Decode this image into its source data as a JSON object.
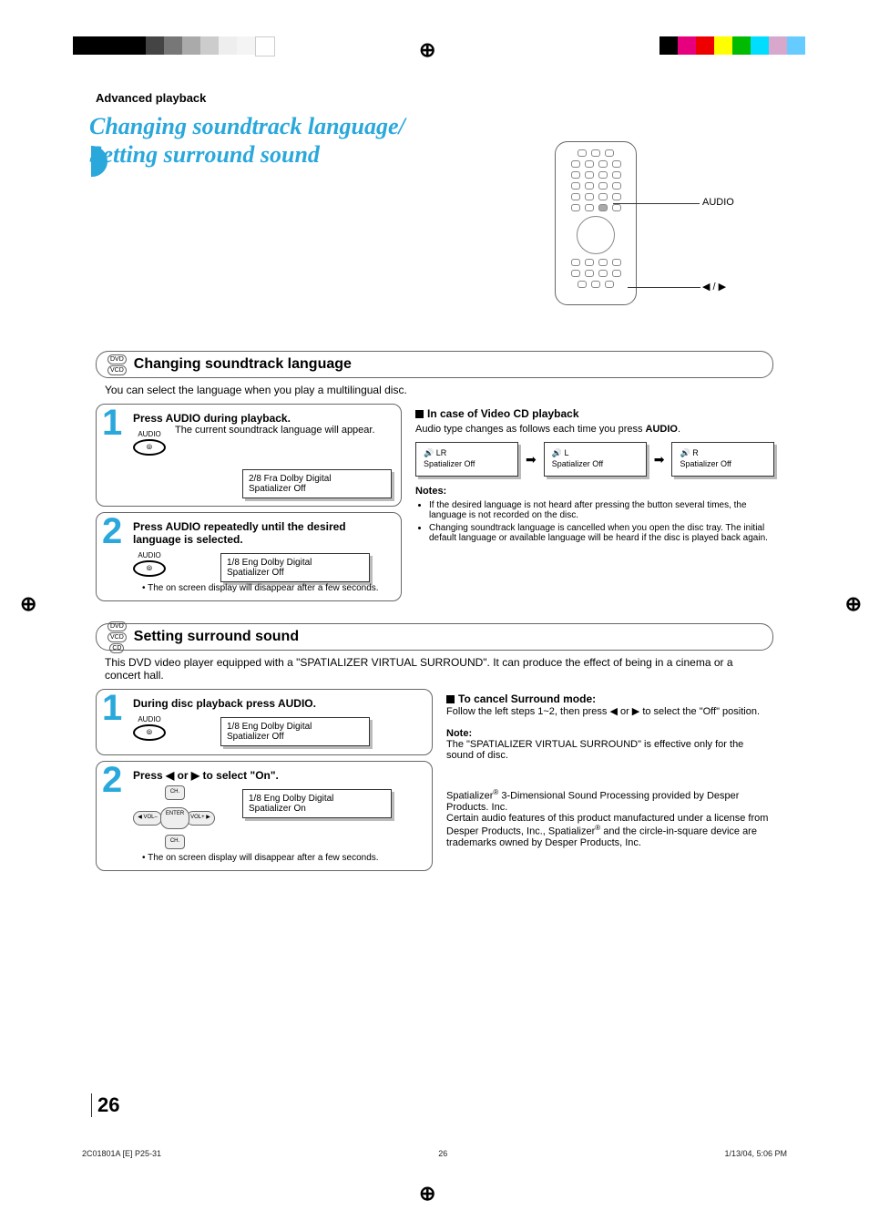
{
  "header": {
    "section": "Advanced playback"
  },
  "title": {
    "line": "Changing soundtrack language/\nSetting surround sound"
  },
  "remote": {
    "audio_label": "AUDIO",
    "arrow_label": "◀ / ▶"
  },
  "badges": {
    "dvd": "DVD",
    "vcd": "VCD",
    "cd": "CD"
  },
  "sec1": {
    "title": "Changing soundtrack language",
    "intro": "You can select the language when you play a multilingual disc.",
    "step1_head": "Press AUDIO during playback.",
    "audio_label": "AUDIO",
    "step1_text": "The current soundtrack language will appear.",
    "osd1_l1": "2/8 Fra Dolby Digital",
    "osd1_l2": "Spatializer Off",
    "step2_head": "Press AUDIO repeatedly until the desired language is selected.",
    "osd2_l1": "1/8 Eng Dolby Digital",
    "osd2_l2": "Spatializer Off",
    "bullet": "The on screen display will disappear after a few seconds.",
    "vcd_head": "In case of Video CD playback",
    "vcd_intro_a": "Audio type changes as follows each time you press ",
    "vcd_intro_b": "AUDIO",
    "vcd_intro_c": ".",
    "flow1_l1": "LR",
    "flow1_l2": "Spatializer Off",
    "flow2_l1": "L",
    "flow2_l2": "Spatializer Off",
    "flow3_l1": "R",
    "flow3_l2": "Spatializer Off",
    "notes_head": "Notes:",
    "note1": "If the desired language is not heard after pressing the button several times, the language is not recorded on the disc.",
    "note2": "Changing soundtrack language is cancelled when you open the disc tray. The initial default language or available language will be heard if the disc is played back again."
  },
  "sec2": {
    "title": "Setting surround sound",
    "intro": "This DVD video player equipped with a \"SPATIALIZER VIRTUAL SURROUND\". It can produce the effect of being in a cinema or a concert hall.",
    "step1_head": "During disc playback press AUDIO.",
    "osd1_l1": "1/8 Eng Dolby Digital",
    "osd1_l2": "Spatializer Off",
    "step2_head": "Press ◀ or ▶ to select \"On\".",
    "osd2_l1": "1/8 Eng Dolby Digital",
    "osd2_l2": "Spatializer On",
    "bullet": "The on screen display will disappear after a few seconds.",
    "dpad": {
      "up": "CH.",
      "dn": "CH.",
      "l": "VOL–",
      "r": "VOL+",
      "c": "ENTER"
    },
    "cancel_head": "To cancel Surround mode",
    "cancel_body": "Follow the left steps 1~2, then press ◀ or ▶ to select the \"Off\" position.",
    "note_head": "Note:",
    "note_body": "The \"SPATIALIZER VIRTUAL SURROUND\" is effective only for the sound of disc.",
    "legal1": "Spatializer",
    "legal2": " 3-Dimensional Sound Processing provided by Desper Products. Inc.",
    "legal3": "Certain audio features of this product manufactured under a license from Desper Products, Inc., Spatializer",
    "legal4": " and the circle-in-square device are trademarks owned by Desper Products, Inc."
  },
  "pagenum": "26",
  "footer": {
    "left": "2C01801A [E] P25-31",
    "mid": "26",
    "right": "1/13/04, 5:06 PM"
  }
}
